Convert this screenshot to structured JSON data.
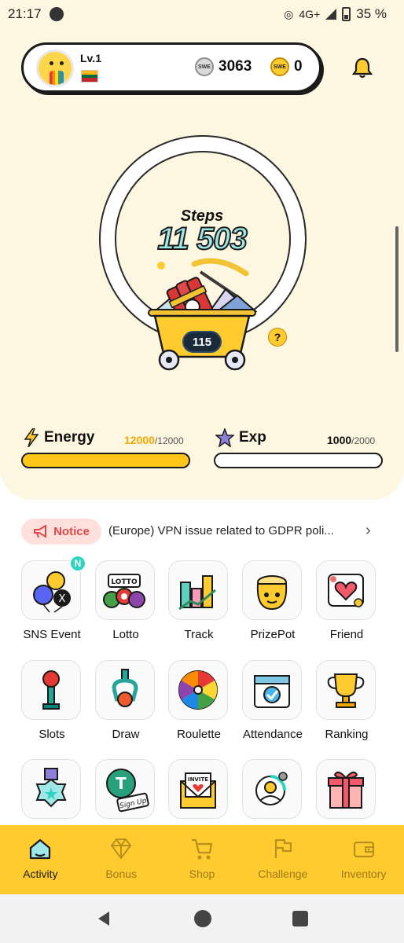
{
  "status_bar": {
    "time": "21:17",
    "network": "4G+",
    "battery": "35 %"
  },
  "profile": {
    "level": "Lv.1",
    "country": "Lithuania",
    "silver_coins": "3063",
    "gold_coins": "0",
    "silver_coin_label": "SWE",
    "gold_coin_label": "SWE"
  },
  "steps": {
    "label": "Steps",
    "value": "11 503",
    "cart_value": "115",
    "help": "?"
  },
  "energy": {
    "label": "Energy",
    "current": "12000",
    "max": "/12000",
    "fill": 1.0
  },
  "exp": {
    "label": "Exp",
    "current": "1000",
    "max": "/2000",
    "fill": 0.5
  },
  "notice": {
    "label": "Notice",
    "text": "(Europe) VPN issue related to GDPR poli..."
  },
  "grid": {
    "row1": [
      {
        "label": "SNS Event",
        "badge": "N"
      },
      {
        "label": "Lotto",
        "tile_text": "LOTTO"
      },
      {
        "label": "Track"
      },
      {
        "label": "PrizePot"
      },
      {
        "label": "Friend"
      }
    ],
    "row2": [
      {
        "label": "Slots"
      },
      {
        "label": "Draw"
      },
      {
        "label": "Roulette"
      },
      {
        "label": "Attendance"
      },
      {
        "label": "Ranking"
      }
    ],
    "row3": [
      {
        "label": ""
      },
      {
        "label": "",
        "tile_text": "Sign Up"
      },
      {
        "label": "",
        "tile_text": "INVITE"
      },
      {
        "label": ""
      },
      {
        "label": ""
      }
    ]
  },
  "bottom_nav": [
    {
      "label": "Activity",
      "icon": "home-icon",
      "active": true
    },
    {
      "label": "Bonus",
      "icon": "diamond-icon",
      "active": false
    },
    {
      "label": "Shop",
      "icon": "cart-icon",
      "active": false
    },
    {
      "label": "Challenge",
      "icon": "flag-icon",
      "active": false
    },
    {
      "label": "Inventory",
      "icon": "wallet-icon",
      "active": false
    }
  ],
  "colors": {
    "accent": "#ffcb2e",
    "cream": "#fdf6e1",
    "notice_red": "#e04848",
    "teal": "#2ed4c0"
  }
}
